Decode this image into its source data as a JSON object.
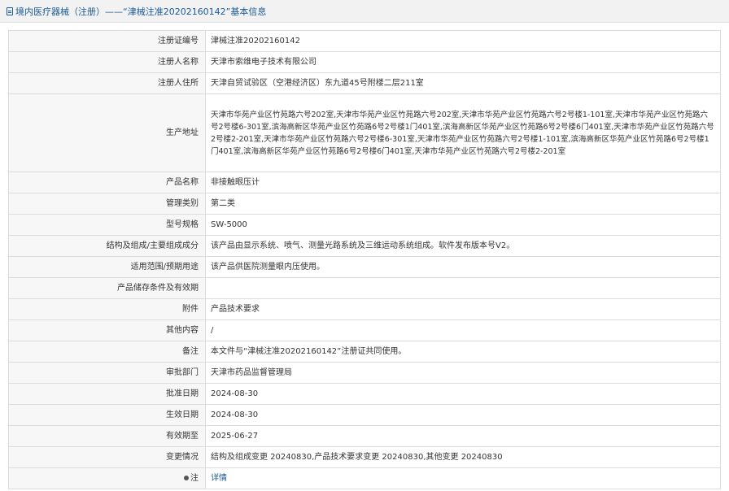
{
  "header": {
    "title": "境内医疗器械（注册）——“津械注准20202160142”基本信息",
    "icon": "document-icon"
  },
  "rows": [
    {
      "label": "注册证编号",
      "value": "津械注准20202160142"
    },
    {
      "label": "注册人名称",
      "value": "天津市索维电子技术有限公司"
    },
    {
      "label": "注册人住所",
      "value": "天津自贸试验区（空港经济区）东九道45号附楼二层211室"
    },
    {
      "label": "生产地址",
      "value": "天津市华苑产业区竹苑路六号202室,天津市华苑产业区竹苑路六号202室,天津市华苑产业区竹苑路六号2号楼1-101室,天津市华苑产业区竹苑路六号2号楼6-301室,滨海高新区华苑产业区竹苑路6号2号楼1门401室,滨海高新区华苑产业区竹苑路6号2号楼6门401室,天津市华苑产业区竹苑路六号2号楼2-201室,天津市华苑产业区竹苑路六号2号楼6-301室,天津市华苑产业区竹苑路六号2号楼1-101室,滨海高新区华苑产业区竹苑路6号2号楼1门401室,滨海高新区华苑产业区竹苑路6号2号楼6门401室,天津市华苑产业区竹苑路六号2号楼2-201室"
    },
    {
      "label": "产品名称",
      "value": "非接触眼压计"
    },
    {
      "label": "管理类别",
      "value": "第二类"
    },
    {
      "label": "型号规格",
      "value": "SW-5000"
    },
    {
      "label": "结构及组成/主要组成成分",
      "value": "该产品由显示系统、喷气、测量光路系统及三维运动系统组成。软件发布版本号V2。"
    },
    {
      "label": "适用范围/预期用途",
      "value": "该产品供医院测量眼内压使用。"
    },
    {
      "label": "产品储存条件及有效期",
      "value": ""
    },
    {
      "label": "附件",
      "value": "产品技术要求"
    },
    {
      "label": "其他内容",
      "value": "/"
    },
    {
      "label": "备注",
      "value": "本文件与“津械注准20202160142”注册证共同使用。"
    },
    {
      "label": "审批部门",
      "value": "天津市药品监督管理局"
    },
    {
      "label": "批准日期",
      "value": "2024-08-30"
    },
    {
      "label": "生效日期",
      "value": "2024-08-30"
    },
    {
      "label": "有效期至",
      "value": "2025-06-27"
    },
    {
      "label": "变更情况",
      "value": "结构及组成变更 20240830,产品技术要求变更 20240830,其他变更 20240830"
    }
  ],
  "note": {
    "label": "注",
    "icon": "pin-icon",
    "value": "详情"
  }
}
